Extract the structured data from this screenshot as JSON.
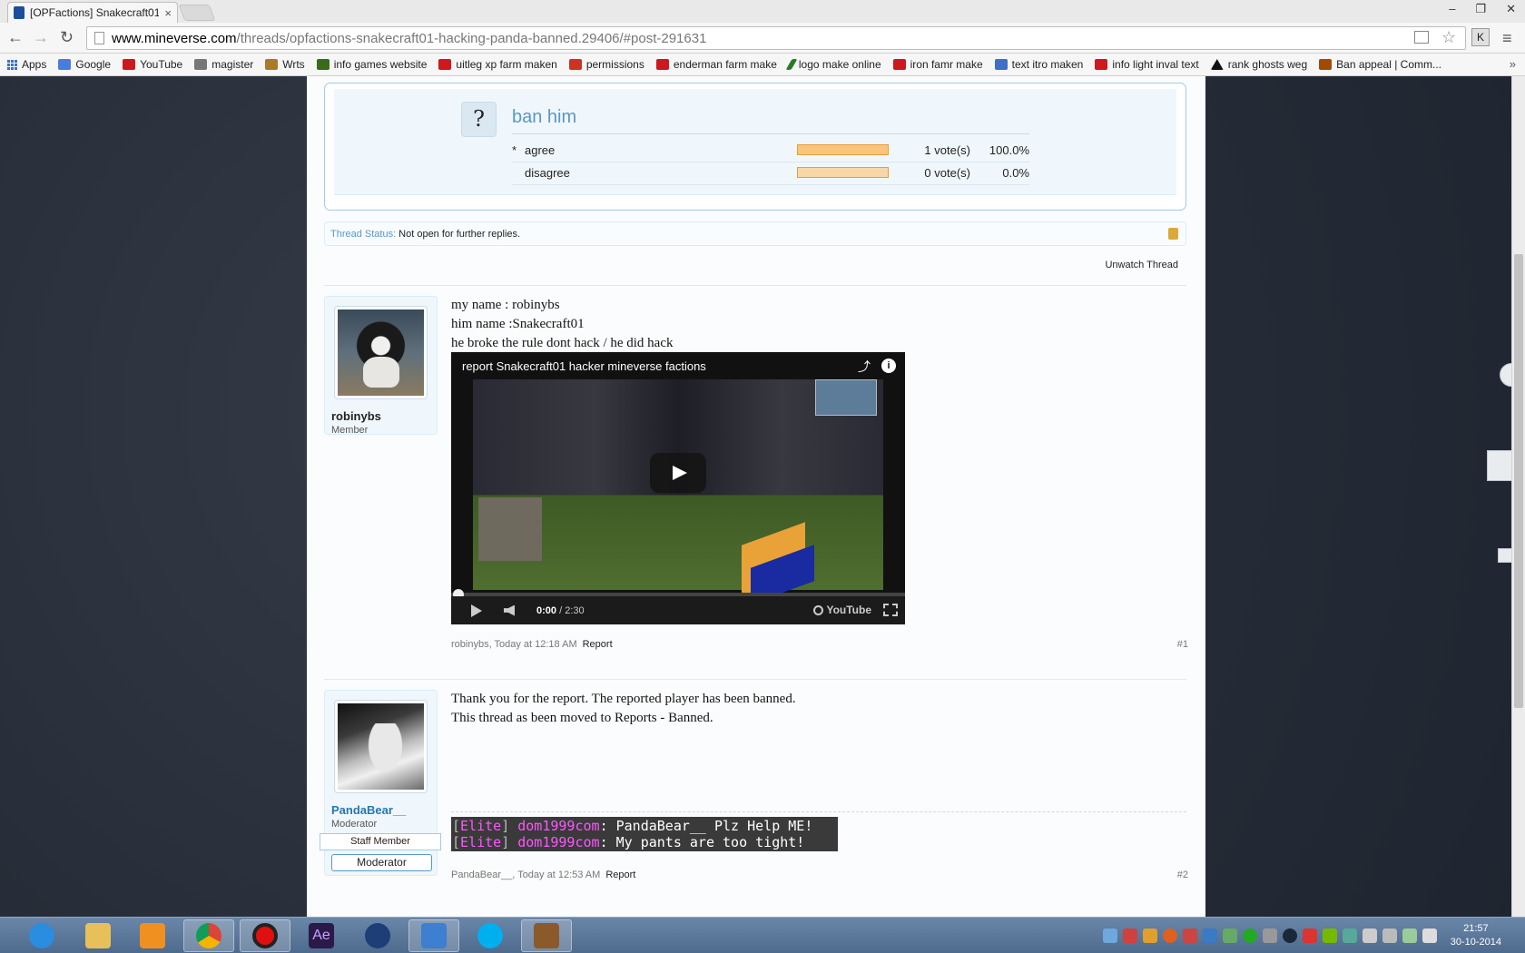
{
  "browser": {
    "tab_title": "[OPFactions] Snakecraft01",
    "tab_close": "×",
    "url_host": "www.mineverse.com",
    "url_path": "/threads/opfactions-snakecraft01-hacking-panda-banned.29406/#post-291631",
    "extension_label": "K",
    "window_controls": [
      "–",
      "❐",
      "✕"
    ],
    "bookmarks": [
      {
        "label": "Apps",
        "icon": "apps-grid-icon"
      },
      {
        "label": "Google",
        "icon": "google-icon"
      },
      {
        "label": "YouTube",
        "icon": "youtube-icon"
      },
      {
        "label": "magister",
        "icon": "people-icon"
      },
      {
        "label": "Wrts",
        "icon": "wrts-icon"
      },
      {
        "label": "info games website",
        "icon": "smiley-icon"
      },
      {
        "label": "uitleg xp farm maken",
        "icon": "youtube-icon"
      },
      {
        "label": "permissions",
        "icon": "bookmark-icon"
      },
      {
        "label": "enderman farm make",
        "icon": "youtube-icon"
      },
      {
        "label": "logo make online",
        "icon": "pen-icon"
      },
      {
        "label": "iron famr make",
        "icon": "youtube-icon"
      },
      {
        "label": "text itro maken",
        "icon": "link-icon"
      },
      {
        "label": "info light inval text",
        "icon": "youtube-icon"
      },
      {
        "label": "rank ghosts weg",
        "icon": "letter-a-icon"
      },
      {
        "label": "Ban appeal | Comm...",
        "icon": "ban-icon"
      }
    ],
    "bookmarks_more": "»"
  },
  "poll": {
    "icon_glyph": "?",
    "question": "ban him",
    "options": [
      {
        "marker": "*",
        "label": "agree",
        "votes": "1 vote(s)",
        "percent": "100.0%",
        "share": 1.0
      },
      {
        "marker": "",
        "label": "disagree",
        "votes": "0 vote(s)",
        "percent": "0.0%",
        "share": 0.0
      }
    ]
  },
  "thread_status": {
    "label": "Thread Status:",
    "value": "Not open for further replies."
  },
  "unwatch_label": "Unwatch Thread",
  "posts": [
    {
      "username": "robinybs",
      "user_title": "Member",
      "lines": [
        "my name : robinybs",
        "him name :Snakecraft01",
        "he broke the rule dont hack / he did hack"
      ],
      "video": {
        "title": "report Snakecraft01 hacker mineverse factions",
        "time_current": "0:00",
        "time_total": "/ 2:30",
        "brand": "YouTube",
        "progress": 0.0
      },
      "meta": "robinybs, Today at 12:18 AM",
      "report_label": "Report",
      "number": "#1"
    },
    {
      "username": "PandaBear__",
      "user_title": "Moderator",
      "ribbon": "Staff Member",
      "badge": "Moderator",
      "lines": [
        "Thank you for the report. The reported player has been banned.",
        "This thread as been moved to Reports - Banned."
      ],
      "signature": [
        {
          "open": "[",
          "rank": "Elite",
          "close": "]",
          "name": " dom1999com",
          "colon": ":",
          "text": " PandaBear__ Plz Help ME!"
        },
        {
          "open": "[",
          "rank": "Elite",
          "close": "]",
          "name": " dom1999com",
          "colon": ":",
          "text": " My pants are too tight!"
        }
      ],
      "meta": "PandaBear__, Today at 12:53 AM",
      "report_label": "Report",
      "number": "#2"
    }
  ],
  "taskbar": {
    "apps": [
      "internet-explorer-icon",
      "file-explorer-icon",
      "media-player-icon",
      "chrome-icon",
      "recorder-icon",
      "after-effects-icon",
      "cinema4d-icon",
      "notepad-icon",
      "skype-icon",
      "minecraft-icon"
    ],
    "ae_label": "Ae",
    "time": "21:57",
    "date": "30-10-2014"
  },
  "colors": {
    "accent_blue": "#5898c6",
    "link_blue": "#2577b1",
    "poll_bar": "#fbc47d",
    "signature_pink": "#ff55ff"
  }
}
